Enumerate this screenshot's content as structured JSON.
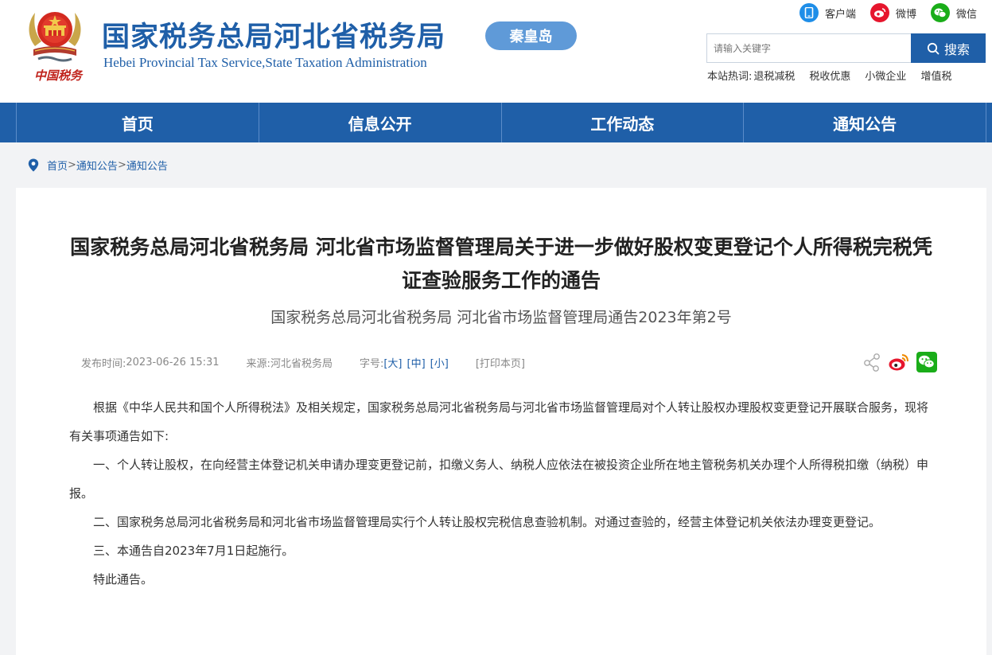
{
  "header": {
    "title": "国家税务总局河北省税务局",
    "subtitle": "Hebei Provincial Tax Service,State Taxation Administration",
    "emblem_text": "中国税务",
    "city": "秦皇岛",
    "top_links": [
      {
        "label": "客户端",
        "icon": "phone-icon",
        "color": "#1f8ee8"
      },
      {
        "label": "微博",
        "icon": "weibo-icon",
        "color": "#e6162d"
      },
      {
        "label": "微信",
        "icon": "wechat-icon",
        "color": "#1aad19"
      }
    ],
    "search": {
      "placeholder": "请输入关键字",
      "button_label": "搜索"
    },
    "hotwords": {
      "label": "本站热词:",
      "items": [
        "退税减税",
        "税收优惠",
        "小微企业",
        "增值税"
      ]
    }
  },
  "nav": {
    "items": [
      "首页",
      "信息公开",
      "工作动态",
      "通知公告"
    ]
  },
  "breadcrumb": {
    "items": [
      "首页",
      "通知公告",
      "通知公告"
    ],
    "separator": ">"
  },
  "article": {
    "title": "国家税务总局河北省税务局 河北省市场监督管理局关于进一步做好股权变更登记个人所得税完税凭证查验服务工作的通告",
    "doc_no": "国家税务总局河北省税务局 河北省市场监督管理局通告2023年第2号",
    "meta": {
      "publish_label": "发布时间:",
      "publish_time": "2023-06-26 15:31",
      "source_label": "来源:",
      "source": "河北省税务局",
      "fontsize_label": "字号:",
      "size_large": "[大]",
      "size_medium": "[中]",
      "size_small": "[小]",
      "print_label": "[打印本页]"
    },
    "paragraphs": [
      "根据《中华人民共和国个人所得税法》及相关规定，国家税务总局河北省税务局与河北省市场监督管理局对个人转让股权办理股权变更登记开展联合服务，现将有关事项通告如下:",
      "一、个人转让股权，在向经营主体登记机关申请办理变更登记前，扣缴义务人、纳税人应依法在被投资企业所在地主管税务机关办理个人所得税扣缴（纳税）申报。",
      "二、国家税务总局河北省税务局和河北省市场监督管理局实行个人转让股权完税信息查验机制。对通过查验的，经营主体登记机关依法办理变更登记。",
      "三、本通告自2023年7月1日起施行。",
      "特此通告。"
    ]
  },
  "colors": {
    "primary": "#1f5fa8",
    "badge": "#5f9ad8",
    "page_bg": "#f2f3f5"
  }
}
